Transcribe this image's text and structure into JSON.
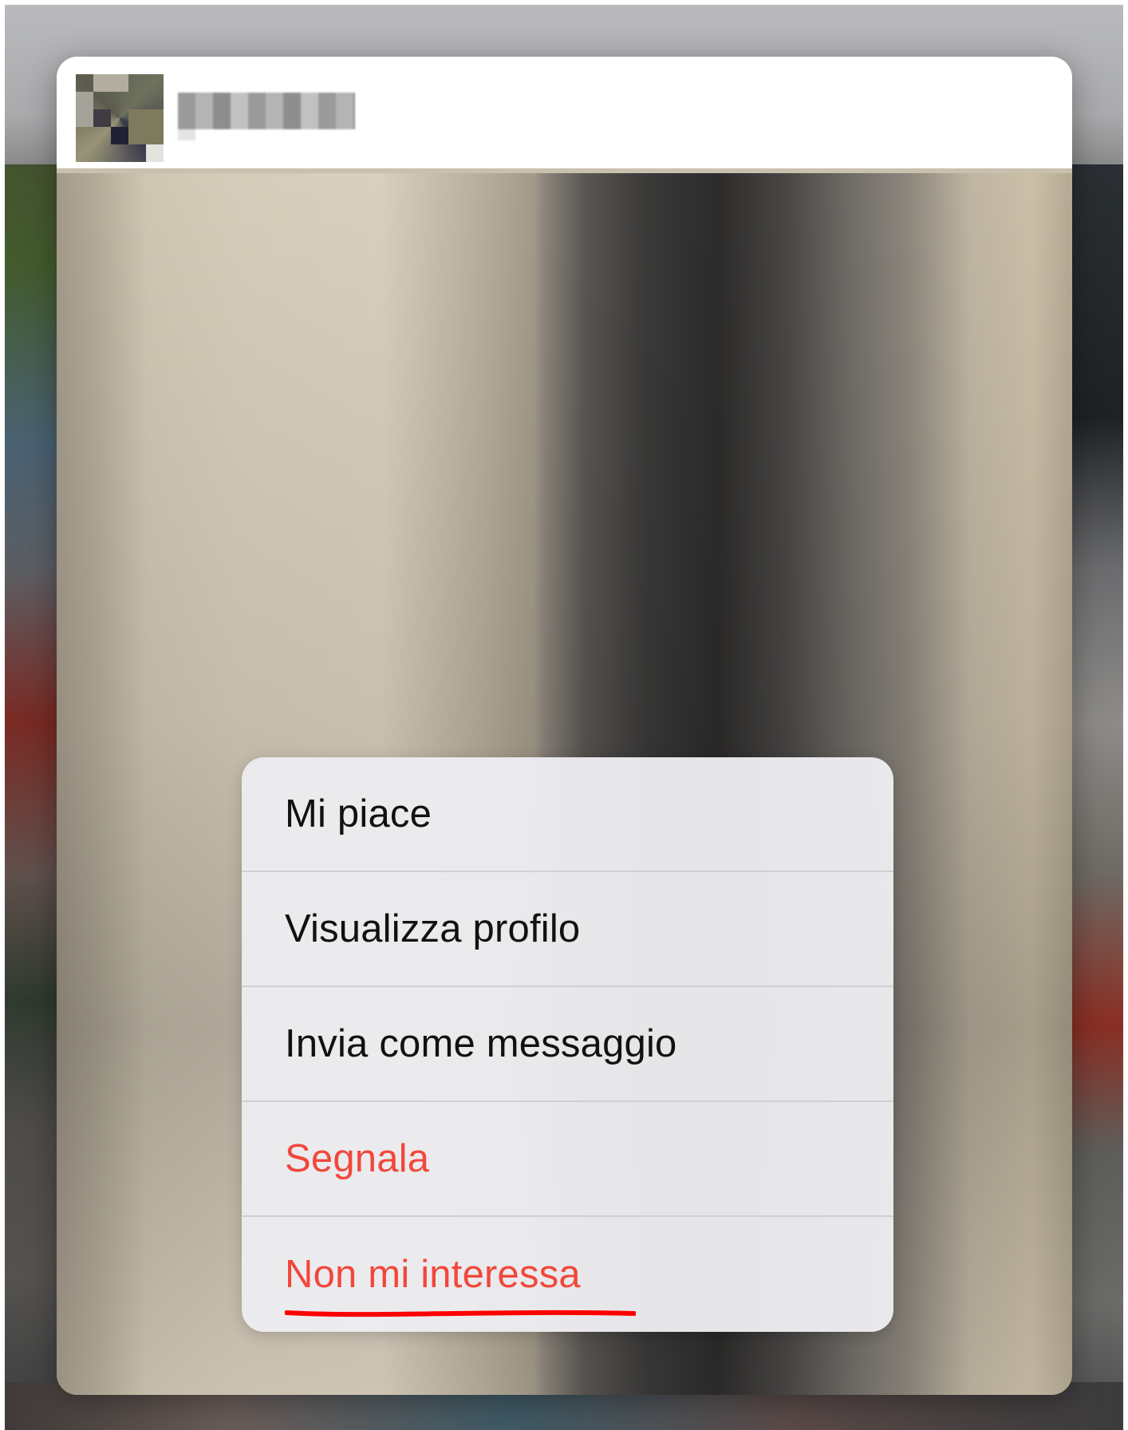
{
  "menu": {
    "items": [
      {
        "label": "Mi piace",
        "destructive": false
      },
      {
        "label": "Visualizza profilo",
        "destructive": false
      },
      {
        "label": "Invia come messaggio",
        "destructive": false
      },
      {
        "label": "Segnala",
        "destructive": true
      },
      {
        "label": "Non mi interessa",
        "destructive": true,
        "annotated": true
      }
    ]
  },
  "colors": {
    "destructive": "#f2473c",
    "annotation": "#ff0000",
    "menu_background": "#ececf0",
    "text": "#111111"
  },
  "icons": {
    "avatar": "pixelated-avatar",
    "username": "pixelated-username"
  }
}
